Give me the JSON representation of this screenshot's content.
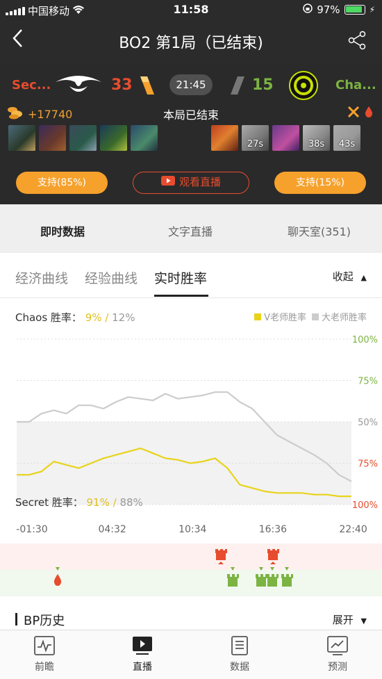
{
  "status": {
    "carrier": "中国移动",
    "time": "11:58",
    "battery": "97%"
  },
  "nav": {
    "title": "BO2   第1局（已结束)"
  },
  "match": {
    "team_left": "Sec...",
    "score_left": "33",
    "timer": "21:45",
    "score_right": "15",
    "team_right": "Cha...",
    "gold_lead": "+17740",
    "state": "本局已结束",
    "respawn_timers": [
      "27s",
      "38s",
      "43s"
    ],
    "support_left": "支持(85%)",
    "watch_live": "观看直播",
    "support_right": "支持(15%)",
    "colors": {
      "left": "#e74c2e",
      "right": "#7cb342",
      "accent": "#f6a12c"
    }
  },
  "tabs": [
    "即时数据",
    "文字直播",
    "聊天室(351)"
  ],
  "subtabs": [
    "经济曲线",
    "经验曲线",
    "实时胜率"
  ],
  "collapse_label": "收起",
  "chaos_rate": {
    "label": "Chaos 胜率：",
    "v": "9%",
    "sep": " / ",
    "d": "12%"
  },
  "secret_rate": {
    "label": "Secret 胜率：",
    "v": "91%",
    "sep": " / ",
    "d": "88%"
  },
  "legend": {
    "v": "V老师胜率",
    "d": "大老师胜率"
  },
  "chart_data": {
    "type": "line",
    "x_ticks": [
      "-01:30",
      "04:32",
      "10:34",
      "16:36",
      "22:40"
    ],
    "y_ticks_right": [
      "100%",
      "75%",
      "50%",
      "75%",
      "100%"
    ],
    "series": [
      {
        "name": "大老师胜率",
        "color": "#cccccc",
        "values": [
          50,
          50,
          55,
          57,
          55,
          60,
          60,
          58,
          62,
          65,
          64,
          63,
          67,
          64,
          65,
          66,
          68,
          68,
          62,
          58,
          50,
          42,
          38,
          34,
          30,
          25,
          18,
          14
        ]
      },
      {
        "name": "V老师胜率",
        "color": "#e8d31a",
        "values": [
          18,
          18,
          20,
          26,
          24,
          22,
          25,
          28,
          30,
          32,
          34,
          31,
          28,
          27,
          25,
          26,
          28,
          22,
          12,
          10,
          8,
          7,
          7,
          7,
          6,
          6,
          5,
          5
        ]
      }
    ]
  },
  "bp": {
    "title": "BP历史",
    "expand": "展开"
  },
  "bottom_nav": [
    "前瞻",
    "直播",
    "数据",
    "预测"
  ]
}
